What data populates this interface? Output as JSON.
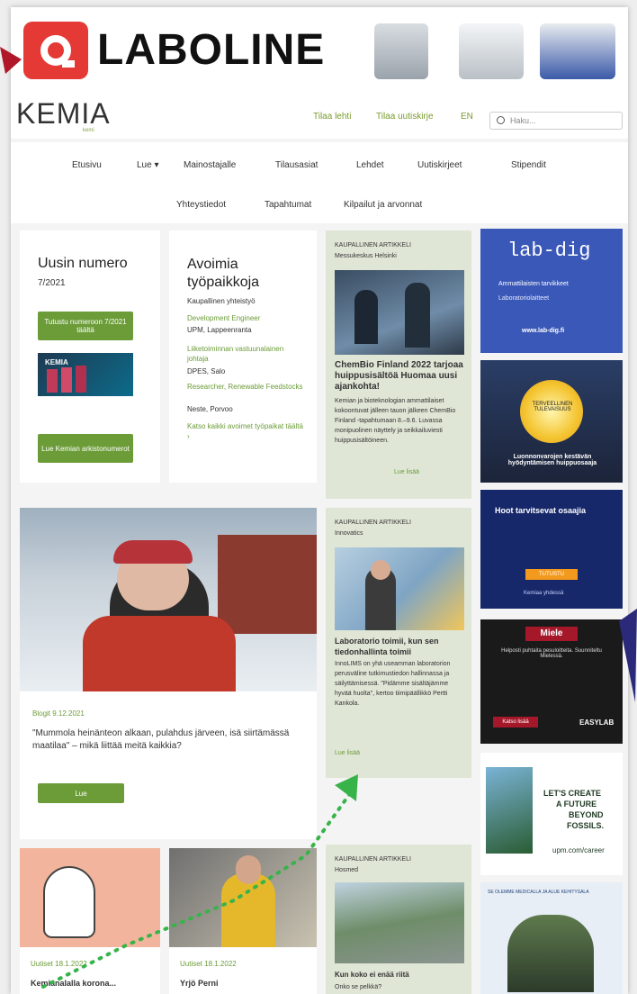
{
  "banner": {
    "brand": "LABOLINE",
    "logo_letter": "Q"
  },
  "header": {
    "site_name": "KEMIA",
    "site_sub": "kemi",
    "links": [
      "Tilaa lehti",
      "Tilaa uutiskirje",
      "EN"
    ],
    "search_placeholder": "Haku..."
  },
  "nav": {
    "row1": [
      "Etusivu",
      "Lue ▾",
      "Mainostajalle",
      "Tilausasiat",
      "Lehdet",
      "Uutiskirjeet",
      "Stipendit"
    ],
    "row2": [
      "Yhteystiedot",
      "Tapahtumat",
      "Kilpailut ja arvonnat"
    ]
  },
  "issue": {
    "title": "Uusin numero",
    "number": "7/2021",
    "btn_read": "Tutustu numeroon 7/2021 täältä",
    "btn_old": "Lue Kemian arkistonumerot",
    "cover_label": "KEMIA"
  },
  "jobs": {
    "title": "Avoimia työpaikkoja",
    "subtitle": "Kaupallinen yhteistyö",
    "items": [
      {
        "role": "Development Engineer",
        "org": "UPM, Lappeenranta"
      },
      {
        "role": "Liiketoiminnan vastuunalainen johtaja",
        "org": "DPES, Salo"
      },
      {
        "role": "Researcher, Renewable Feedstocks",
        "org": "Neste, Porvoo"
      }
    ],
    "all_link": "Katso kaikki avoimet työpaikat täältä ›"
  },
  "commercial1": {
    "tag": "KAUPALLINEN ARTIKKELI",
    "sponsor": "Messukeskus Helsinki",
    "headline": "ChemBio Finland 2022 tarjoaa huippusisältöä Huomaa uusi ajankohta!",
    "body": "Kemian ja bioteknologian ammattilaiset kokoontuvat jälleen tauon jälkeen ChemBio Finland -tapahtumaan 8.–9.6. Luvassa monipuolinen näyttely ja seikkailuviesti huippusisältöineen.",
    "more": "Lue lisää"
  },
  "feature": {
    "meta": "Blogit 9.12.2021",
    "headline": "\"Mummola heinänteon alkaan, pulahdus järveen, isä siirtämässä maatilaa\" – mikä liittää meitä kaikkia?",
    "btn": "Lue"
  },
  "commercial2": {
    "tag": "KAUPALLINEN ARTIKKELI",
    "sponsor": "Innovatics",
    "headline": "Laboratorio toimii, kun sen tiedonhallinta toimii",
    "body": "InnoLIMS on yhä useamman laboratorion perusväline tutkimustiedon hallinnassa ja säilyttämisessä. \"Pidämme sisältäjämme hyvää huolta\", kertoo tiimipäällikkö Pertti Kankola.",
    "more": "Lue lisää"
  },
  "commercial3": {
    "tag": "KAUPALLINEN ARTIKKELI",
    "sponsor": "Hosmed",
    "headline": "Kun koko ei enää riitä",
    "body": "Onko se pelkkä?"
  },
  "bottom": [
    {
      "meta": "Uutiset 18.1.2022",
      "headline": "Kemianalalla korona..."
    },
    {
      "meta": "Uutiset 18.1.2022",
      "headline": "Yrjö Perni"
    }
  ],
  "ads": {
    "labdig": {
      "logo": "lab-dig",
      "text1": "Ammattilaisten tarvikkeet",
      "text2": "Laboratoriolaitteet",
      "url": "www.lab-dig.fi"
    },
    "sun": {
      "badge": "TERVEELLINEN TULEVAISUUS",
      "caption": "Luonnonvarojen kestävän hyödyntämisen huippuosaaja"
    },
    "blue": {
      "title": "Hoot tarvitsevat osaajia",
      "btn": "TUTUSTU",
      "foot": "Kemiaa yhdessä"
    },
    "miele": {
      "brand": "Miele",
      "text": "Helposti puhtaita pesuloitteita. Suunniteltu Mielessä.",
      "btn": "Katso lisää",
      "easy": "EASYLAB"
    },
    "upm": {
      "line1": "LET'S CREATE",
      "line2": "A FUTURE",
      "line3": "BEYOND",
      "line4": "FOSSILS.",
      "url": "upm.com/career"
    },
    "last": {
      "text": "SE OLEMME MEDICALLA JA ALUE KEHITYSALA"
    }
  }
}
